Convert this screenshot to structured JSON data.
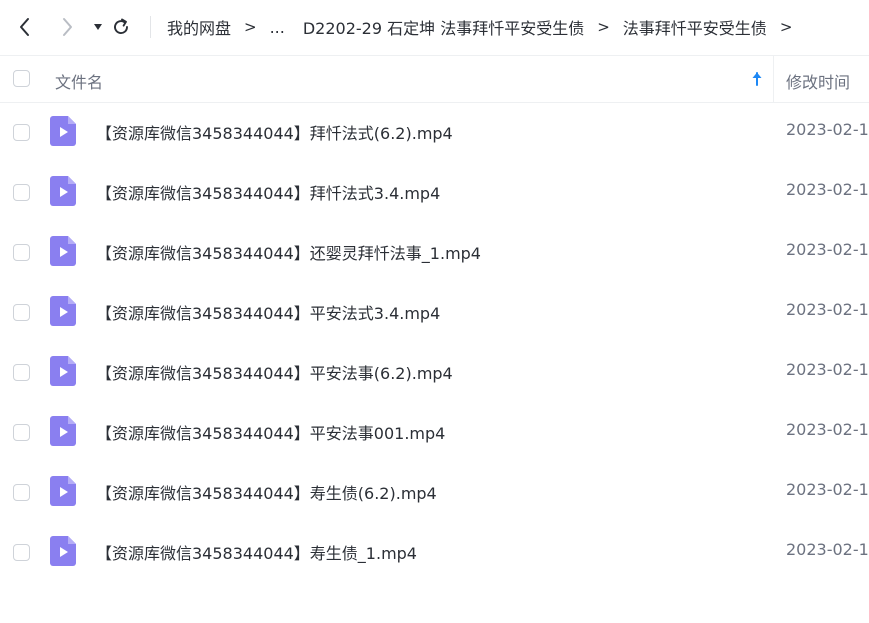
{
  "breadcrumb": {
    "root": "我的网盘",
    "ellipsis": "...",
    "level1": "D2202-29 石定坤 法事拜忏平安受生债",
    "level2": "法事拜忏平安受生债",
    "separator": ">"
  },
  "table": {
    "col_name": "文件名",
    "col_time": "修改时间",
    "sort_direction": "ascending"
  },
  "files": [
    {
      "name": "【资源库微信3458344044】拜忏法式(6.2).mp4",
      "time": "2023-02-1"
    },
    {
      "name": "【资源库微信3458344044】拜忏法式3.4.mp4",
      "time": "2023-02-1"
    },
    {
      "name": "【资源库微信3458344044】还婴灵拜忏法事_1.mp4",
      "time": "2023-02-1"
    },
    {
      "name": "【资源库微信3458344044】平安法式3.4.mp4",
      "time": "2023-02-1"
    },
    {
      "name": "【资源库微信3458344044】平安法事(6.2).mp4",
      "time": "2023-02-1"
    },
    {
      "name": "【资源库微信3458344044】平安法事001.mp4",
      "time": "2023-02-1"
    },
    {
      "name": "【资源库微信3458344044】寿生债(6.2).mp4",
      "time": "2023-02-1"
    },
    {
      "name": "【资源库微信3458344044】寿生债_1.mp4",
      "time": "2023-02-1"
    }
  ],
  "colors": {
    "accent": "#1e88f5",
    "video_icon": "#8a7ff0",
    "text": "#2b2f36",
    "muted": "#6c7280"
  },
  "icons": {
    "back": "chevron-left-icon",
    "forward": "chevron-right-icon",
    "dropdown": "caret-down-icon",
    "refresh": "refresh-icon",
    "sort": "arrow-up-icon",
    "file": "video-file-icon"
  }
}
